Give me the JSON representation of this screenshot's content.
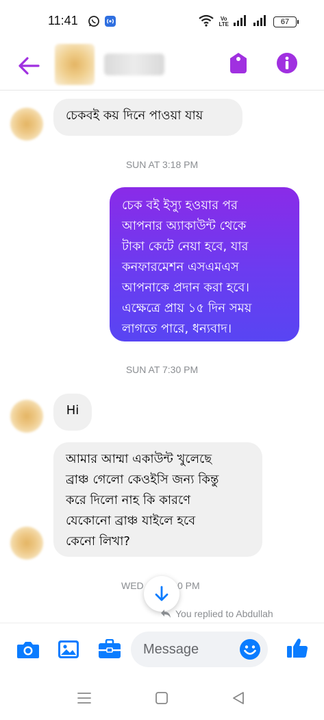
{
  "status_bar": {
    "time": "11:41",
    "battery": "67",
    "volte_top": "Vo",
    "volte_bottom": "LTE"
  },
  "header": {
    "back_icon": "arrow-left-icon",
    "tag_icon": "tag-icon",
    "info_icon": "info-icon",
    "accent_color": "#a030e0"
  },
  "messages": [
    {
      "direction": "incoming",
      "text": "চেকবই কয় দিনে পাওয়া যায়"
    },
    {
      "type": "timestamp",
      "text": "SUN AT 3:18 PM"
    },
    {
      "direction": "outgoing",
      "lines": [
        "চেক বই ইস্যু হওয়ার পর",
        "আপনার অ্যাকাউন্ট থেকে",
        "টাকা কেটে নেয়া হবে, যার",
        "কনফারমেশন এসএমএস",
        "আপনাকে প্রদান করা হবে।",
        "এক্ষেত্রে প্রায় ১৫ দিন সময়",
        "লাগতে পারে, ধন্যবাদ।"
      ]
    },
    {
      "type": "timestamp",
      "text": "SUN AT 7:30 PM"
    },
    {
      "direction": "incoming",
      "text": "Hi"
    },
    {
      "direction": "incoming",
      "lines": [
        "আমার আম্মা একাউন্ট খুলেছে",
        "ব্রাঞ্চ গেলো কেওইসি জন্য কিন্তু",
        "করে দিলো নাহ কি কারণে",
        "যেকোনো ব্রাঞ্চ যাইলে হবে",
        "কেনো লিখা?"
      ]
    },
    {
      "type": "timestamp",
      "text_left": "WED",
      "text_right": "0 PM"
    }
  ],
  "replied_note": "You replied to Abdullah",
  "composer": {
    "placeholder": "Message",
    "icons": [
      "camera-icon",
      "image-icon",
      "briefcase-icon",
      "emoji-icon",
      "thumbs-up-icon"
    ],
    "icon_color": "#0a7cff"
  },
  "nav_bar": {
    "icons": [
      "menu-icon",
      "home-square-icon",
      "back-triangle-icon"
    ]
  }
}
